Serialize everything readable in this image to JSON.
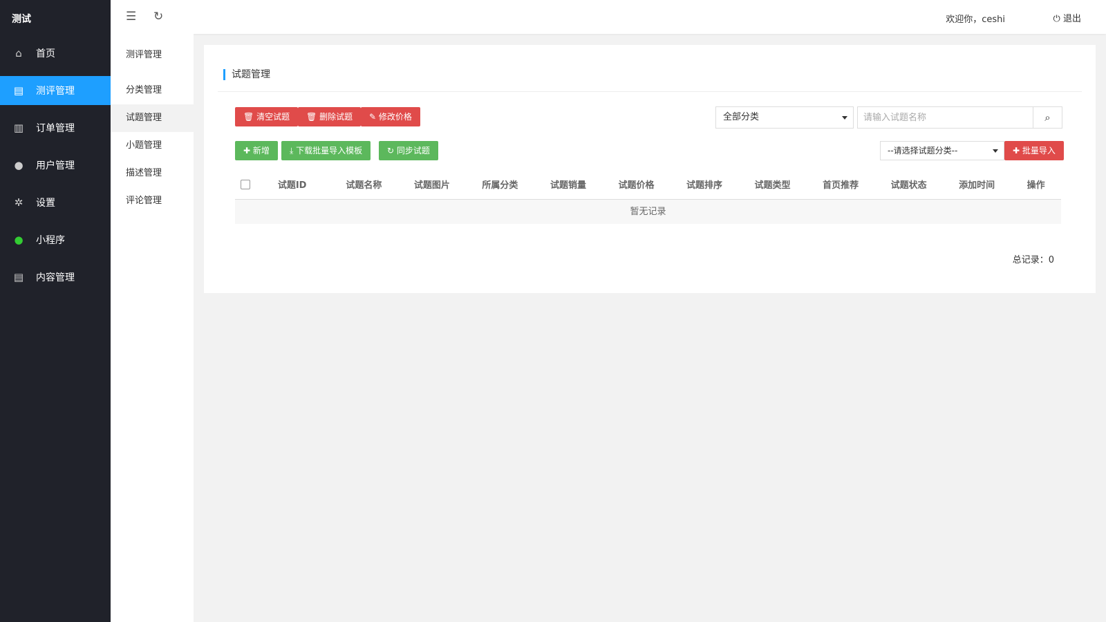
{
  "app": {
    "logo": "测试"
  },
  "nav": [
    {
      "label": "首页",
      "icon": "⌂"
    },
    {
      "label": "测评管理",
      "icon": "▤"
    },
    {
      "label": "订单管理",
      "icon": "▥"
    },
    {
      "label": "用户管理",
      "icon": "●"
    },
    {
      "label": "设置",
      "icon": "✲"
    },
    {
      "label": "小程序",
      "icon": "●"
    },
    {
      "label": "内容管理",
      "icon": "▤"
    }
  ],
  "submenu": {
    "title": "测评管理",
    "items": [
      "分类管理",
      "试题管理",
      "小题管理",
      "描述管理",
      "评论管理"
    ]
  },
  "header": {
    "welcome": "欢迎你，ceshi",
    "logout": "退出"
  },
  "card": {
    "title": "试题管理",
    "buttons": {
      "clear": "清空试题",
      "delete": "删除试题",
      "price": "修改价格",
      "add": "新增",
      "download": "下载批量导入模板",
      "sync": "同步试题",
      "import": "批量导入"
    },
    "category_select": "全部分类",
    "search_placeholder": "请输入试题名称",
    "import_select": "--请选择试题分类--",
    "columns": [
      "试题ID",
      "试题名称",
      "试题图片",
      "所属分类",
      "试题销量",
      "试题价格",
      "试题排序",
      "试题类型",
      "首页推荐",
      "试题状态",
      "添加时间",
      "操作"
    ],
    "empty": "暂无记录",
    "total": "总记录：0"
  }
}
